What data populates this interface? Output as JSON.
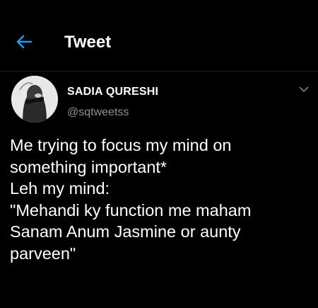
{
  "header": {
    "back_icon": "arrow-left-icon",
    "title": "Tweet"
  },
  "author": {
    "avatar_icon": "profile-photo",
    "name": "SADIA QURESHI",
    "handle": "@sqtweetss"
  },
  "menu": {
    "caret_icon": "chevron-down-icon"
  },
  "tweet": {
    "lines": [
      "Me trying to focus my mind on",
      "something important*",
      "Leh my mind:",
      "\"Mehandi ky function me maham",
      "Sanam Anum Jasmine or aunty",
      "parveen\""
    ]
  },
  "colors": {
    "background": "#000000",
    "accent": "#1d9bf0",
    "text": "#ffffff",
    "secondary_text": "#8b9197"
  }
}
